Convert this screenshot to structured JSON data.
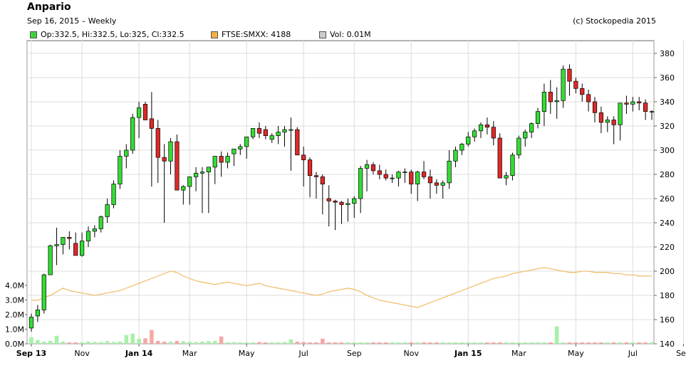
{
  "header": {
    "title": "Anpario",
    "subtitle": "Sep 16, 2015 – Weekly",
    "copyright": "(c) Stockopedia 2015"
  },
  "legend": [
    {
      "label": "Op:332.5, Hi:332.5, Lo:325, Cl:332.5",
      "color": "#3fd23f"
    },
    {
      "label": "FTSE:SMXX: 4188",
      "color": "#f0b040"
    },
    {
      "label": "Vol: 0.01M",
      "color": "#cccccc"
    }
  ],
  "colors": {
    "up": "#33dd33",
    "down": "#e02828",
    "ftse_line": "#f0c070",
    "vol_up": "#a8f0a8",
    "vol_down": "#f5a8a8",
    "grid": "#dcdcdc"
  },
  "chart_data": {
    "type": "candlestick",
    "x_ticks": [
      {
        "label": "Sep 13",
        "week": 0,
        "bold": true
      },
      {
        "label": "Nov",
        "week": 8,
        "bold": false
      },
      {
        "label": "Jan 14",
        "week": 17,
        "bold": true
      },
      {
        "label": "Mar",
        "week": 25,
        "bold": false
      },
      {
        "label": "May",
        "week": 34,
        "bold": false
      },
      {
        "label": "Jul",
        "week": 43,
        "bold": false
      },
      {
        "label": "Sep",
        "week": 51,
        "bold": false
      },
      {
        "label": "Nov",
        "week": 60,
        "bold": false
      },
      {
        "label": "Jan 15",
        "week": 69,
        "bold": true
      },
      {
        "label": "Mar",
        "week": 77,
        "bold": false
      },
      {
        "label": "May",
        "week": 86,
        "bold": false
      },
      {
        "label": "Jul",
        "week": 95,
        "bold": false
      },
      {
        "label": "Sep",
        "week": 103,
        "bold": false
      }
    ],
    "price_axis": {
      "min": 140,
      "max": 380,
      "ticks": [
        140,
        160,
        180,
        200,
        220,
        240,
        260,
        280,
        300,
        320,
        340,
        360,
        380
      ]
    },
    "volume_axis": {
      "min": 0,
      "max": 4000000,
      "tick_labels": [
        "0.0M",
        "1.0M",
        "2.0M",
        "3.0M",
        "4.0M"
      ],
      "tick_values": [
        0,
        1000000,
        2000000,
        3000000,
        4000000
      ]
    },
    "ohlc": [
      [
        153,
        165,
        150,
        162
      ],
      [
        163,
        172,
        158,
        168
      ],
      [
        168,
        198,
        165,
        197
      ],
      [
        197,
        222,
        198,
        221
      ],
      [
        221,
        236,
        205,
        222
      ],
      [
        222,
        226,
        214,
        228
      ],
      [
        228,
        233,
        218,
        227
      ],
      [
        223,
        232,
        215,
        213
      ],
      [
        213,
        232,
        212,
        225
      ],
      [
        225,
        237,
        220,
        233
      ],
      [
        233,
        238,
        228,
        235
      ],
      [
        235,
        246,
        232,
        245
      ],
      [
        245,
        260,
        240,
        255
      ],
      [
        255,
        275,
        252,
        272
      ],
      [
        272,
        300,
        268,
        295
      ],
      [
        295,
        305,
        285,
        300
      ],
      [
        300,
        330,
        297,
        327
      ],
      [
        327,
        340,
        310,
        335
      ],
      [
        338,
        340,
        335,
        325
      ],
      [
        326,
        348,
        270,
        318
      ],
      [
        318,
        325,
        273,
        294
      ],
      [
        294,
        305,
        240,
        291
      ],
      [
        291,
        310,
        280,
        307
      ],
      [
        307,
        313,
        269,
        267
      ],
      [
        267,
        271,
        255,
        270
      ],
      [
        270,
        275,
        255,
        278
      ],
      [
        278,
        286,
        266,
        281
      ],
      [
        281,
        286,
        248,
        282
      ],
      [
        282,
        285,
        248,
        286
      ],
      [
        286,
        295,
        272,
        295
      ],
      [
        295,
        299,
        278,
        290
      ],
      [
        290,
        298,
        285,
        295
      ],
      [
        297,
        300,
        287,
        301
      ],
      [
        301,
        305,
        296,
        303
      ],
      [
        303,
        308,
        293,
        311
      ],
      [
        311,
        318,
        309,
        318
      ],
      [
        318,
        323,
        310,
        314
      ],
      [
        317,
        320,
        309,
        312
      ],
      [
        309,
        314,
        306,
        312
      ],
      [
        312,
        320,
        305,
        315
      ],
      [
        315,
        320,
        303,
        317
      ],
      [
        317,
        327,
        283,
        317
      ],
      [
        317,
        319,
        301,
        296
      ],
      [
        296,
        303,
        270,
        292
      ],
      [
        292,
        294,
        261,
        279
      ],
      [
        279,
        282,
        260,
        278
      ],
      [
        278,
        280,
        247,
        272
      ],
      [
        260,
        271,
        237,
        258
      ],
      [
        258,
        259,
        234,
        257
      ],
      [
        257,
        258,
        239,
        255
      ],
      [
        255,
        260,
        241,
        256
      ],
      [
        256,
        262,
        244,
        260
      ],
      [
        260,
        287,
        248,
        285
      ],
      [
        285,
        292,
        266,
        288
      ],
      [
        288,
        290,
        280,
        283
      ],
      [
        283,
        288,
        276,
        280
      ],
      [
        280,
        284,
        275,
        277
      ],
      [
        277,
        280,
        273,
        277
      ],
      [
        277,
        283,
        270,
        282
      ],
      [
        282,
        285,
        273,
        282
      ],
      [
        282,
        284,
        264,
        272
      ],
      [
        272,
        283,
        258,
        282
      ],
      [
        282,
        291,
        276,
        278
      ],
      [
        278,
        284,
        260,
        273
      ],
      [
        273,
        276,
        264,
        271
      ],
      [
        271,
        275,
        260,
        273
      ],
      [
        273,
        300,
        268,
        291
      ],
      [
        291,
        303,
        286,
        300
      ],
      [
        300,
        306,
        296,
        305
      ],
      [
        305,
        315,
        303,
        311
      ],
      [
        311,
        318,
        307,
        316
      ],
      [
        316,
        323,
        310,
        321
      ],
      [
        321,
        327,
        313,
        319
      ],
      [
        319,
        324,
        304,
        310
      ],
      [
        310,
        314,
        278,
        277
      ],
      [
        277,
        282,
        271,
        279
      ],
      [
        279,
        298,
        275,
        296
      ],
      [
        296,
        312,
        293,
        310
      ],
      [
        310,
        317,
        303,
        315
      ],
      [
        315,
        323,
        310,
        322
      ],
      [
        322,
        335,
        318,
        332
      ],
      [
        332,
        355,
        320,
        348
      ],
      [
        348,
        358,
        330,
        340
      ],
      [
        340,
        352,
        326,
        341
      ],
      [
        341,
        370,
        335,
        367
      ],
      [
        367,
        371,
        345,
        357
      ],
      [
        357,
        360,
        347,
        351
      ],
      [
        351,
        355,
        340,
        346
      ],
      [
        346,
        350,
        332,
        340
      ],
      [
        340,
        344,
        323,
        331
      ],
      [
        331,
        336,
        314,
        323
      ],
      [
        323,
        328,
        315,
        325
      ],
      [
        325,
        328,
        305,
        321
      ],
      [
        321,
        328,
        308,
        339
      ],
      [
        339,
        345,
        330,
        338
      ],
      [
        338,
        344,
        332,
        340
      ],
      [
        340,
        344,
        333,
        339
      ],
      [
        339,
        342,
        325,
        332
      ],
      [
        332,
        333,
        325,
        332
      ]
    ],
    "ftse": [
      176,
      176,
      178,
      180,
      183,
      186,
      184,
      183,
      182,
      181,
      180,
      181,
      182,
      183,
      184,
      186,
      188,
      190,
      192,
      194,
      196,
      198,
      200,
      199,
      196,
      194,
      192,
      191,
      190,
      189,
      190,
      191,
      190,
      189,
      188,
      189,
      190,
      188,
      187,
      186,
      185,
      184,
      183,
      182,
      181,
      180,
      181,
      183,
      184,
      185,
      186,
      185,
      183,
      180,
      178,
      176,
      175,
      174,
      173,
      172,
      171,
      170,
      172,
      174,
      176,
      178,
      180,
      182,
      184,
      186,
      188,
      190,
      192,
      194,
      195,
      196,
      198,
      199,
      200,
      201,
      202,
      203,
      202,
      201,
      200,
      199,
      199,
      200,
      200,
      199,
      199,
      199,
      198,
      198,
      197,
      197,
      196,
      196,
      196,
      196,
      196,
      196,
      196,
      196,
      196
    ],
    "volume": [
      450000,
      250000,
      150000,
      200000,
      550000,
      150000,
      100000,
      100000,
      100000,
      150000,
      130000,
      120000,
      180000,
      130000,
      150000,
      600000,
      700000,
      350000,
      380000,
      950000,
      200000,
      150000,
      150000,
      200000,
      180000,
      130000,
      120000,
      150000,
      180000,
      200000,
      500000,
      100000,
      120000,
      100000,
      100000,
      100000,
      120000,
      100000,
      100000,
      100000,
      120000,
      300000,
      150000,
      120000,
      100000,
      100000,
      350000,
      100000,
      100000,
      100000,
      100000,
      100000,
      100000,
      100000,
      100000,
      100000,
      100000,
      100000,
      100000,
      100000,
      100000,
      100000,
      100000,
      100000,
      100000,
      100000,
      100000,
      100000,
      100000,
      100000,
      100000,
      100000,
      100000,
      100000,
      100000,
      100000,
      100000,
      100000,
      100000,
      100000,
      100000,
      100000,
      100000,
      1200000,
      100000,
      100000,
      100000,
      100000,
      100000,
      100000,
      100000,
      100000,
      100000,
      100000,
      100000,
      100000,
      100000,
      100000,
      100000,
      100000,
      100000,
      100000,
      100000,
      100000,
      100000
    ],
    "grid": true,
    "legend_position": "top-left"
  }
}
